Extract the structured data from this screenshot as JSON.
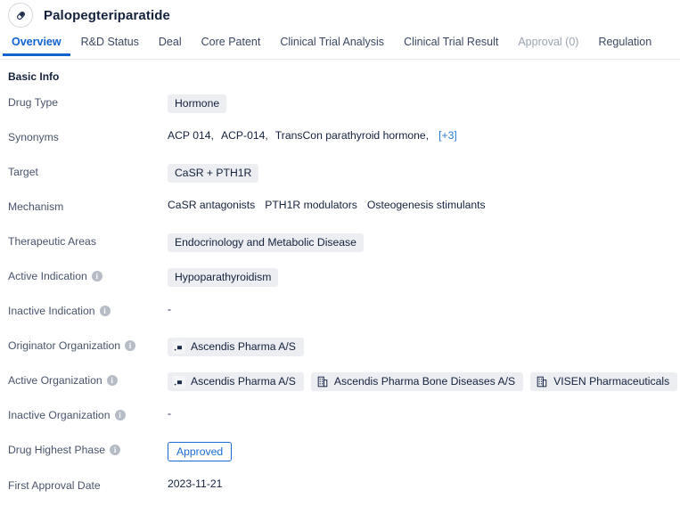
{
  "header": {
    "title": "Palopegteriparatide",
    "avatar_icon": "capsule-pill-icon"
  },
  "tabs": [
    {
      "label": "Overview",
      "state": "active"
    },
    {
      "label": "R&D Status",
      "state": "normal"
    },
    {
      "label": "Deal",
      "state": "normal"
    },
    {
      "label": "Core Patent",
      "state": "normal"
    },
    {
      "label": "Clinical Trial Analysis",
      "state": "normal"
    },
    {
      "label": "Clinical Trial Result",
      "state": "normal"
    },
    {
      "label": "Approval (0)",
      "state": "disabled"
    },
    {
      "label": "Regulation",
      "state": "normal"
    }
  ],
  "basic_info": {
    "section_title": "Basic Info",
    "rows": {
      "drug_type": {
        "label": "Drug Type",
        "chips": [
          "Hormone"
        ]
      },
      "synonyms": {
        "label": "Synonyms",
        "values": [
          "ACP 014,",
          "ACP-014,",
          "TransCon parathyroid hormone,"
        ],
        "more_link": "[+3]"
      },
      "target": {
        "label": "Target",
        "chips": [
          "CaSR + PTH1R"
        ]
      },
      "mechanism": {
        "label": "Mechanism",
        "values": [
          "CaSR antagonists",
          "PTH1R modulators",
          "Osteogenesis stimulants"
        ]
      },
      "therapeutic_areas": {
        "label": "Therapeutic Areas",
        "chips": [
          "Endocrinology and Metabolic Disease"
        ]
      },
      "active_indication": {
        "label": "Active Indication",
        "has_info": true,
        "chips": [
          "Hypoparathyroidism"
        ]
      },
      "inactive_indication": {
        "label": "Inactive Indication",
        "has_info": true,
        "value": "-"
      },
      "originator_organization": {
        "label": "Originator Organization",
        "has_info": true,
        "orgs": [
          {
            "name": "Ascendis Pharma A/S",
            "icon": "company-logo-icon"
          }
        ]
      },
      "active_organization": {
        "label": "Active Organization",
        "has_info": true,
        "orgs": [
          {
            "name": "Ascendis Pharma A/S",
            "icon": "company-logo-icon"
          },
          {
            "name": "Ascendis Pharma Bone Diseases A/S",
            "icon": "building-icon"
          },
          {
            "name": "VISEN Pharmaceuticals",
            "icon": "building-icon"
          }
        ]
      },
      "inactive_organization": {
        "label": "Inactive Organization",
        "has_info": true,
        "value": "-"
      },
      "drug_highest_phase": {
        "label": "Drug Highest Phase",
        "has_info": true,
        "badge": "Approved"
      },
      "first_approval_date": {
        "label": "First Approval Date",
        "value": "2023-11-21"
      }
    }
  },
  "colors": {
    "accent_blue": "#0f62d0",
    "link_blue": "#2b7cd3",
    "badge_blue": "#1a6ad4",
    "chip_bg": "#eceef1",
    "label_gray": "#48536b",
    "disabled_gray": "#9aa3b2"
  }
}
